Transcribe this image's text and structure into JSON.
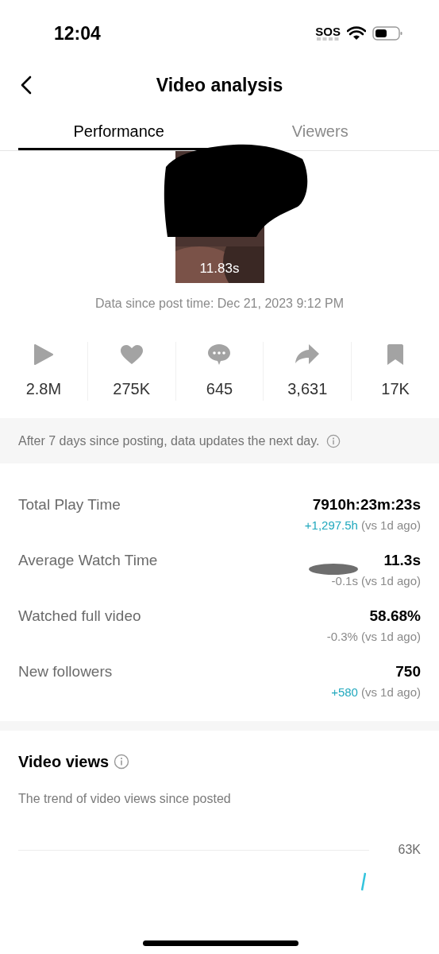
{
  "status_bar": {
    "time": "12:04",
    "carrier": "SOS"
  },
  "header": {
    "title": "Video analysis"
  },
  "tabs": [
    {
      "label": "Performance",
      "selected": true
    },
    {
      "label": "Viewers",
      "selected": false
    }
  ],
  "video": {
    "duration": "11.83s",
    "since": "Data since post time: Dec 21, 2023 9:12 PM"
  },
  "stats": [
    {
      "kind": "plays",
      "value": "2.8M"
    },
    {
      "kind": "likes",
      "value": "275K"
    },
    {
      "kind": "comments",
      "value": "645"
    },
    {
      "kind": "shares",
      "value": "3,631"
    },
    {
      "kind": "saves",
      "value": "17K"
    }
  ],
  "notice": "After 7 days since posting, data updates the next day.",
  "metrics": [
    {
      "label": "Total Play Time",
      "value": "7910h:23m:23s",
      "change": "+1,297.5h",
      "kind": "gain",
      "compare": "(vs 1d ago)",
      "redacted": false
    },
    {
      "label": "Average Watch Time",
      "value": "11.3s",
      "change": "-0.1s",
      "kind": "loss",
      "compare": "(vs 1d ago)",
      "redacted": true
    },
    {
      "label": "Watched full video",
      "value": "58.68%",
      "change": "-0.3%",
      "kind": "loss",
      "compare": "(vs 1d ago)",
      "redacted": false
    },
    {
      "label": "New followers",
      "value": "750",
      "change": "+580",
      "kind": "gain",
      "compare": "(vs 1d ago)",
      "redacted": false
    }
  ],
  "video_views": {
    "title": "Video views",
    "subtitle": "The trend of video views since posted",
    "axis_label": "63K"
  }
}
